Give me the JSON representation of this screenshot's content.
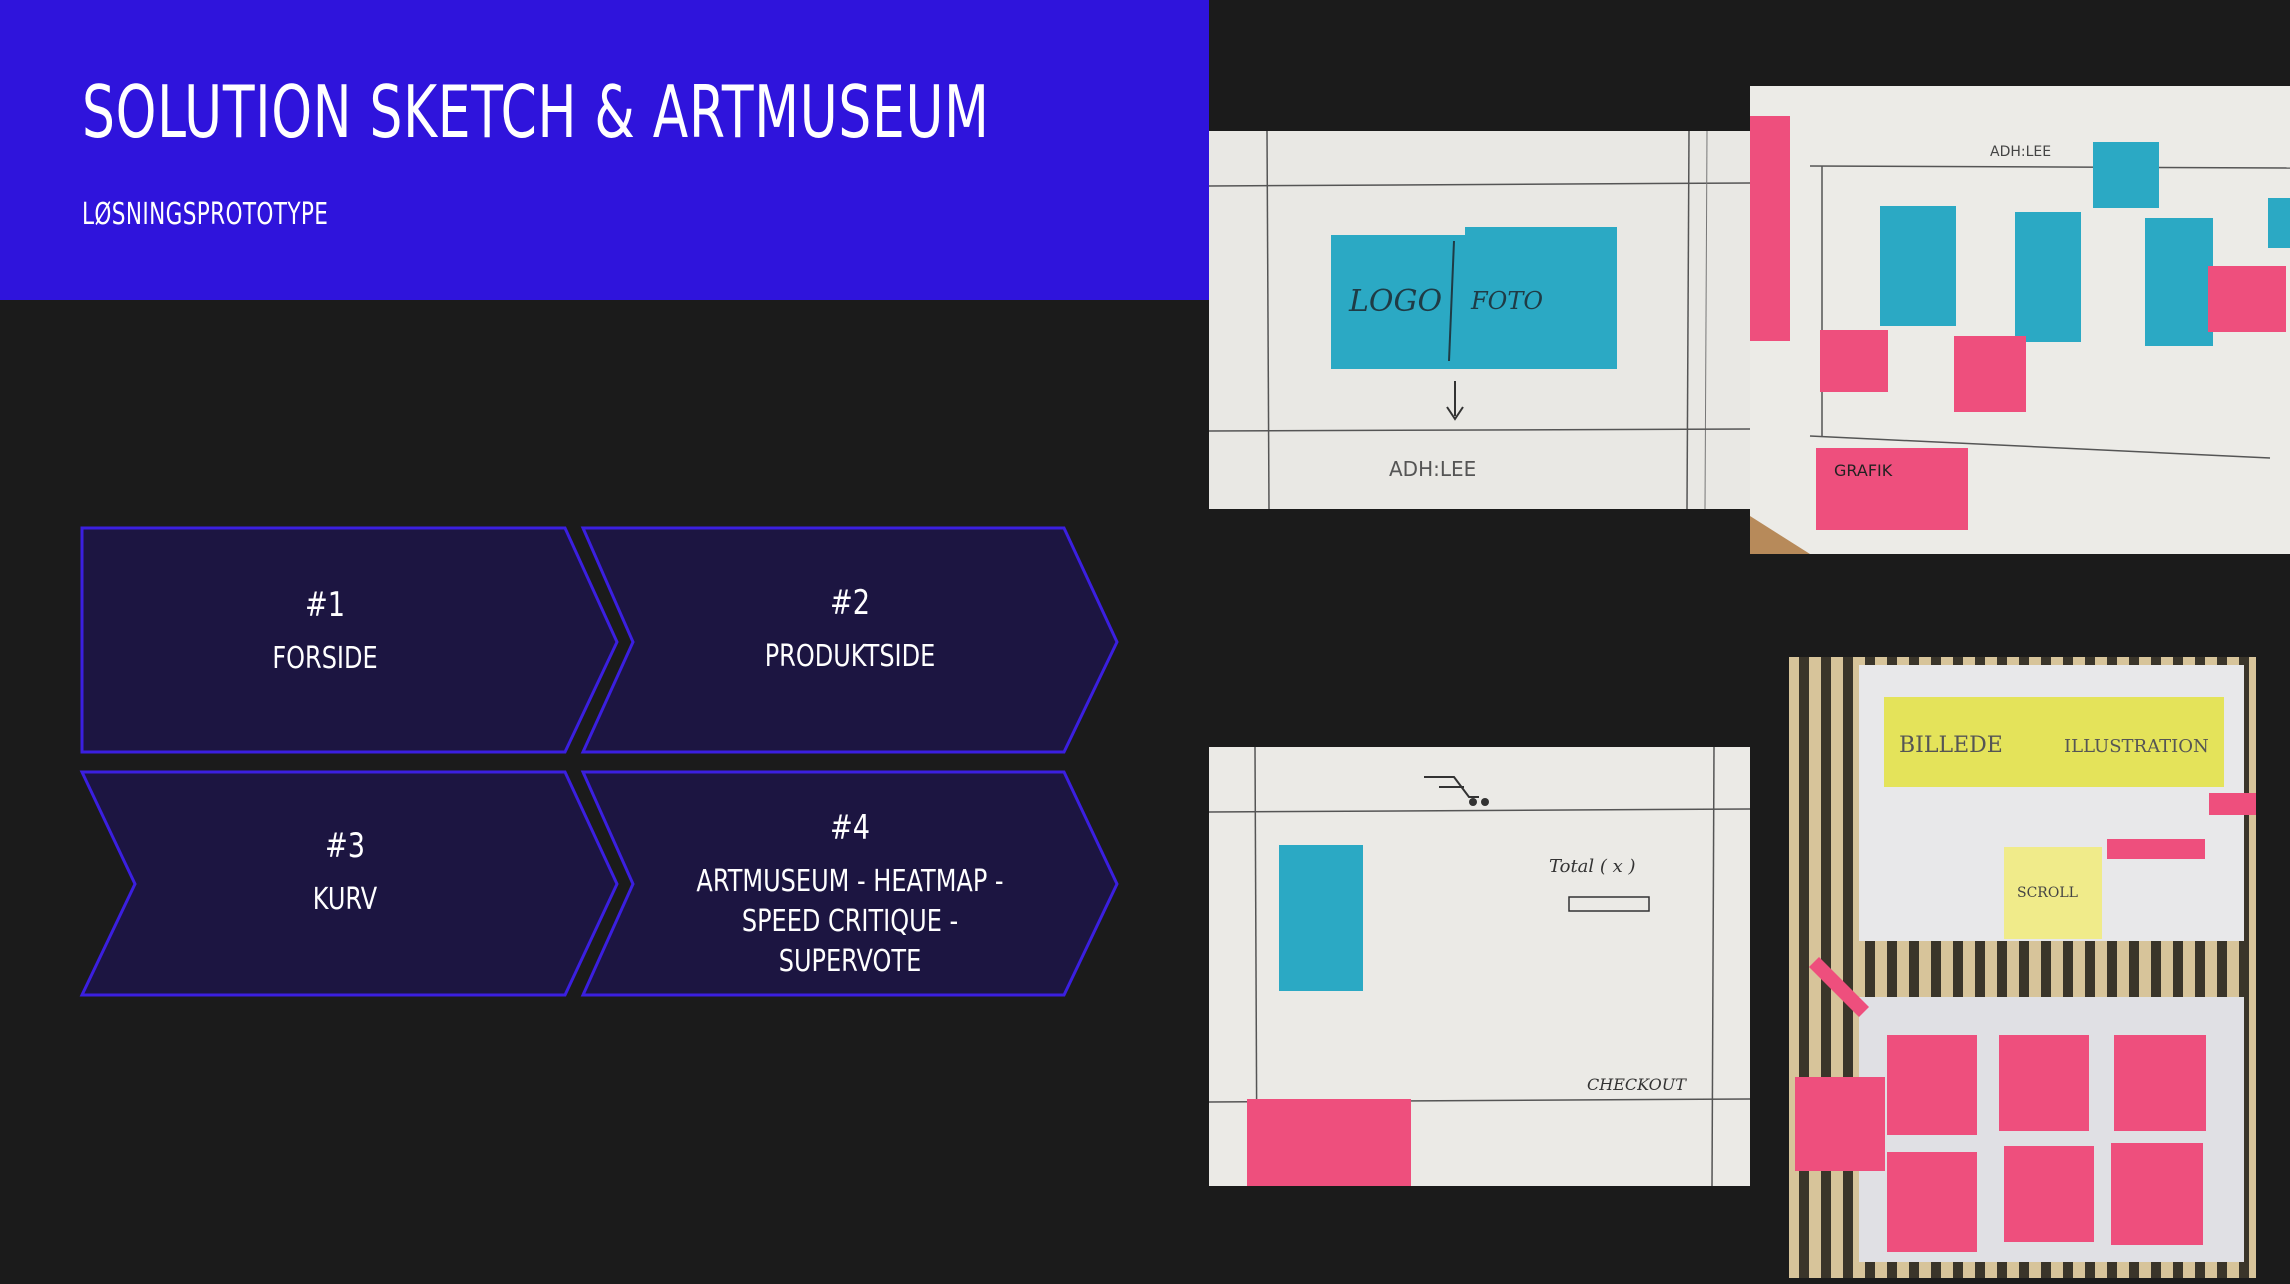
{
  "slide": {
    "title": "SOLUTION SKETCH & ARTMUSEUM",
    "subtitle": "LØSNINGSPROTOTYPE"
  },
  "steps": [
    {
      "number": "#1",
      "label": "FORSIDE"
    },
    {
      "number": "#2",
      "label": "PRODUKTSIDE"
    },
    {
      "number": "#3",
      "label": "KURV"
    },
    {
      "number": "#4",
      "label": "ARTMUSEUM - HEATMAP - SPEED CRITIQUE - SUPERVOTE"
    }
  ],
  "photos": {
    "frontpage_sketch": {
      "labels": [
        "LOGO",
        "FOTO",
        "ADH:LEE"
      ]
    },
    "product_sketch": {
      "labels": [
        "ADH:LEE",
        "GRAFIK"
      ]
    },
    "cart_sketch": {
      "labels": [
        "Total ( x )",
        "CHECKOUT"
      ]
    },
    "wall_sketch": {
      "labels": [
        "BILLEDE",
        "ILLUSTRATION",
        "SCROLL"
      ]
    }
  },
  "colors": {
    "header_bg": "#2f14dc",
    "page_bg": "#1b1b1b",
    "chevron_fill": "#1c1541",
    "chevron_stroke": "#3b1fe0",
    "sticky_teal": "#2ba9c4",
    "sticky_pink": "#ee4f7d",
    "sticky_yellow": "#e4e35a"
  }
}
